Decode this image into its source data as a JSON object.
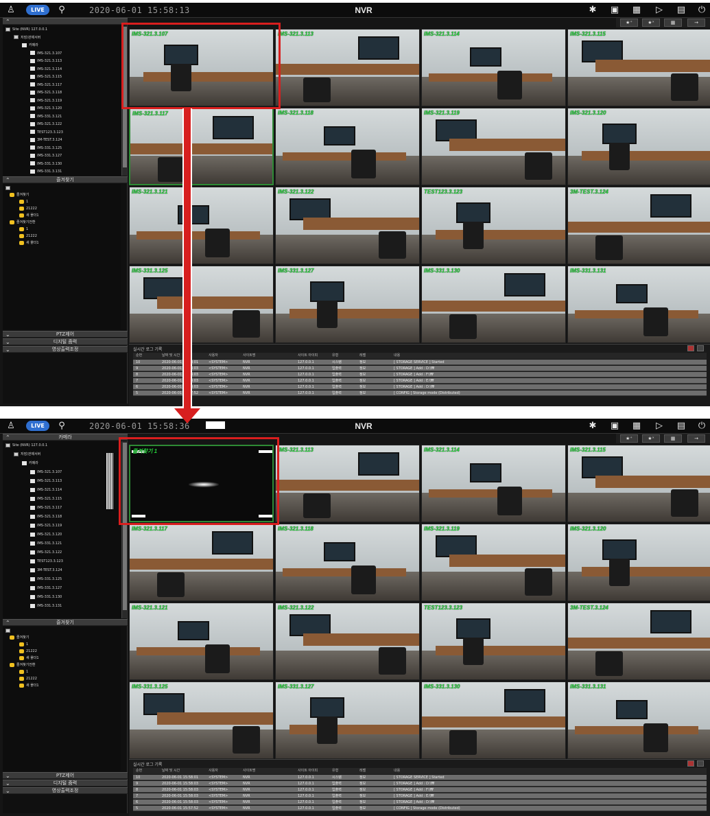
{
  "shot1": {
    "topbar": {
      "live_label": "LIVE",
      "datetime": "2020-06-01 15:58:13",
      "app_title": "NVR",
      "icons": [
        "user-icon",
        "search-icon",
        "settings-icon",
        "camera-icon",
        "screen-icon",
        "playback-icon",
        "monitor-icon",
        "power-icon"
      ]
    },
    "toolbar": [
      "★⁺",
      "★ˣ",
      "▦",
      "→"
    ],
    "sidebar": {
      "panel1_title": "",
      "tree": [
        {
          "label": "Site (NVR) 127.0.0.1",
          "level": 1
        },
        {
          "label": "저장/관제서버",
          "level": 2
        },
        {
          "label": "카메라",
          "level": 3
        },
        {
          "label": "IMS-321.3.107",
          "level": 4
        },
        {
          "label": "IMS-321.3.113",
          "level": 4
        },
        {
          "label": "IMS-321.3.114",
          "level": 4
        },
        {
          "label": "IMS-321.3.115",
          "level": 4
        },
        {
          "label": "IMS-321.3.117",
          "level": 4
        },
        {
          "label": "IMS-321.3.118",
          "level": 4
        },
        {
          "label": "IMS-321.3.119",
          "level": 4
        },
        {
          "label": "IMS-321.3.120",
          "level": 4
        },
        {
          "label": "IMS-331.3.121",
          "level": 4
        },
        {
          "label": "IMS-321.3.122",
          "level": 4
        },
        {
          "label": "TEST123.3.123",
          "level": 4
        },
        {
          "label": "3M-TEST.3.124",
          "level": 4
        },
        {
          "label": "IMS-331.3.125",
          "level": 4
        },
        {
          "label": "IMS-331.3.127",
          "level": 4
        },
        {
          "label": "IMS-331.3.130",
          "level": 4
        },
        {
          "label": "IMS-331.3.131",
          "level": 4
        }
      ],
      "panel2_title": "즐겨찾기",
      "favorites": [
        {
          "label": "즐겨찾기",
          "level": 1
        },
        {
          "label": "1",
          "level": 2
        },
        {
          "label": "21222",
          "level": 2
        },
        {
          "label": "새 폴더1",
          "level": 2
        },
        {
          "label": "즐겨찾기전환",
          "level": 1
        },
        {
          "label": "1",
          "level": 2
        },
        {
          "label": "21222",
          "level": 2
        },
        {
          "label": "새 폴더1",
          "level": 2
        }
      ],
      "bottom_panels": [
        "PTZ제어",
        "디지털 줌력",
        "영상출력조정"
      ]
    },
    "tiles": [
      "IMS-321.3.107",
      "IMS-321.3.113",
      "IMS-321.3.114",
      "IMS-321.3.115",
      "IMS-321.3.117",
      "IMS-321.3.118",
      "IMS-321.3.119",
      "IMS-321.3.120",
      "IMS-321.3.121",
      "IMS-321.3.122",
      "TEST123.3.123",
      "3M-TEST.3.124",
      "IMS-331.3.125",
      "IMS-331.3.127",
      "IMS-331.3.130",
      "IMS-331.3.131"
    ],
    "log": {
      "title": "실시간 로그 기록",
      "columns": [
        "순번",
        "날짜 및 시간",
        "사용자",
        "사이트명",
        "사이트 아이피",
        "유형",
        "레벨",
        "내용"
      ],
      "rows": [
        [
          "10",
          "2020-06-01 15:58:01",
          "<SYSTEM>",
          "NVR",
          "127.0.0.1",
          "시스템",
          "정보",
          "[ STORAGE SERVICE ] Started"
        ],
        [
          "9",
          "2020-06-01 15:58:03",
          "<SYSTEM>",
          "NVR",
          "127.0.0.1",
          "입출력",
          "정보",
          "[ STORAGE ] Add : D:\\₩"
        ],
        [
          "8",
          "2020-06-01 15:58:03",
          "<SYSTEM>",
          "NVR",
          "127.0.0.1",
          "입출력",
          "정보",
          "[ STORAGE ] Add : F:\\₩"
        ],
        [
          "7",
          "2020-06-01 15:58:03",
          "<SYSTEM>",
          "NVR",
          "127.0.0.1",
          "입출력",
          "정보",
          "[ STORAGE ] Add : E:\\₩"
        ],
        [
          "6",
          "2020-06-01 15:58:03",
          "<SYSTEM>",
          "NVR",
          "127.0.0.1",
          "입출력",
          "정보",
          "[ STORAGE ] Add : D:\\₩"
        ],
        [
          "5",
          "2020-06-01 15:57:52",
          "<SYSTEM>",
          "NVR",
          "127.0.0.1",
          "입출력",
          "정보",
          "[ CONFIG ] Storage mode (Distributed)"
        ]
      ]
    }
  },
  "shot2": {
    "topbar": {
      "live_label": "LIVE",
      "datetime": "2020-06-01 15:58:36",
      "app_title": "NVR"
    },
    "sidebar": {
      "panel1_title": "카메라",
      "panel2_title": "즐겨찾기",
      "bottom_panels": [
        "PTZ제어",
        "디지털 줌력",
        "영상출력조정"
      ]
    },
    "tiles": [
      "즐겨찾기 1",
      "IMS-321.3.113",
      "IMS-321.3.114",
      "IMS-321.3.115",
      "IMS-321.3.117",
      "IMS-321.3.118",
      "IMS-321.3.119",
      "IMS-321.3.120",
      "IMS-321.3.121",
      "IMS-321.3.122",
      "TEST123.3.123",
      "3M-TEST.3.124",
      "IMS-331.3.125",
      "IMS-331.3.127",
      "IMS-331.3.130",
      "IMS-331.3.131"
    ],
    "log": {
      "title": "실시간 로그 기록"
    }
  },
  "colors": {
    "highlight": "#d91e1e",
    "camera_label": "#27d23c",
    "live_badge": "#2f6fd0"
  }
}
